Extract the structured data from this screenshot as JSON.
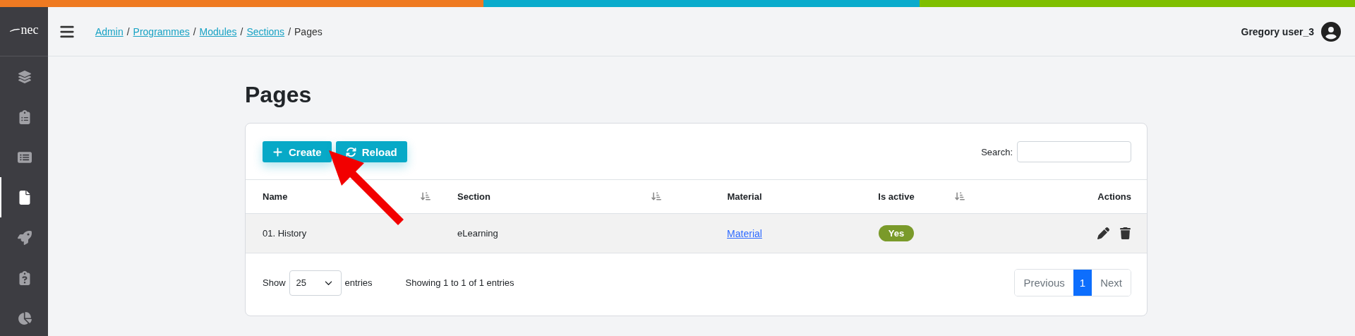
{
  "logo": {
    "text": "nec"
  },
  "sidebar": {
    "items": [
      {
        "kind": "layers",
        "selected": false
      },
      {
        "kind": "clipboard-list",
        "selected": false
      },
      {
        "kind": "list",
        "selected": false
      },
      {
        "kind": "file",
        "selected": true
      },
      {
        "kind": "rocket",
        "selected": false
      },
      {
        "kind": "clipboard-question",
        "selected": false
      },
      {
        "kind": "chart-pie",
        "selected": false
      }
    ]
  },
  "breadcrumb": [
    {
      "label": "Admin",
      "link": true
    },
    {
      "label": "Programmes",
      "link": true
    },
    {
      "label": "Modules",
      "link": true
    },
    {
      "label": "Sections",
      "link": true
    },
    {
      "label": "Pages",
      "link": false
    }
  ],
  "breadcrumb_separator": "/",
  "user": {
    "name": "Gregory user_3"
  },
  "page_title": "Pages",
  "toolbar": {
    "buttons": [
      {
        "kind": "create",
        "label": "Create"
      },
      {
        "kind": "reload",
        "label": "Reload"
      }
    ],
    "search": {
      "label": "Search:"
    }
  },
  "table": {
    "columns": [
      {
        "label": "Name",
        "sortable": true
      },
      {
        "label": "Section",
        "sortable": true
      },
      {
        "label": "Material",
        "sortable": false
      },
      {
        "label": "Is active",
        "sortable": true
      },
      {
        "label": "Actions",
        "sortable": false
      }
    ],
    "rows": [
      {
        "name": "01. History",
        "section": "eLearning",
        "material": "Material",
        "is_active": {
          "label": "Yes",
          "active": true
        }
      }
    ]
  },
  "footer": {
    "show_label": "Show",
    "page_size": "25",
    "entries_label": "entries",
    "info": "Showing 1 to 1 of 1 entries",
    "pagination": [
      {
        "label": "Previous",
        "kind": "nav",
        "selected": false
      },
      {
        "label": "1",
        "kind": "page",
        "selected": true
      },
      {
        "label": "Next",
        "kind": "nav",
        "selected": false
      }
    ]
  },
  "annotation": {
    "kind": "arrow"
  }
}
